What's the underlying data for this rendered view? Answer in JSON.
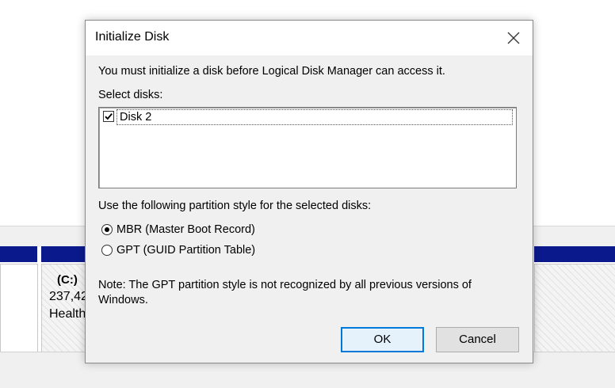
{
  "background": {
    "volume_name": "(C:)",
    "volume_size": "237,42",
    "volume_status": "Health"
  },
  "dialog": {
    "title": "Initialize Disk",
    "message": "You must initialize a disk before Logical Disk Manager can access it.",
    "select_label": "Select disks:",
    "disks": [
      {
        "name": "Disk 2",
        "checked": true
      }
    ],
    "partition_label": "Use the following partition style for the selected disks:",
    "partition_options": [
      {
        "label": "MBR (Master Boot Record)",
        "selected": true
      },
      {
        "label": "GPT (GUID Partition Table)",
        "selected": false
      }
    ],
    "note": "Note: The GPT partition style is not recognized by all previous versions of Windows.",
    "ok_label": "OK",
    "cancel_label": "Cancel"
  },
  "colors": {
    "accent": "#0078d7",
    "volume_bar": "#0a1a8c",
    "dialog_bg": "#f0f0f0"
  }
}
